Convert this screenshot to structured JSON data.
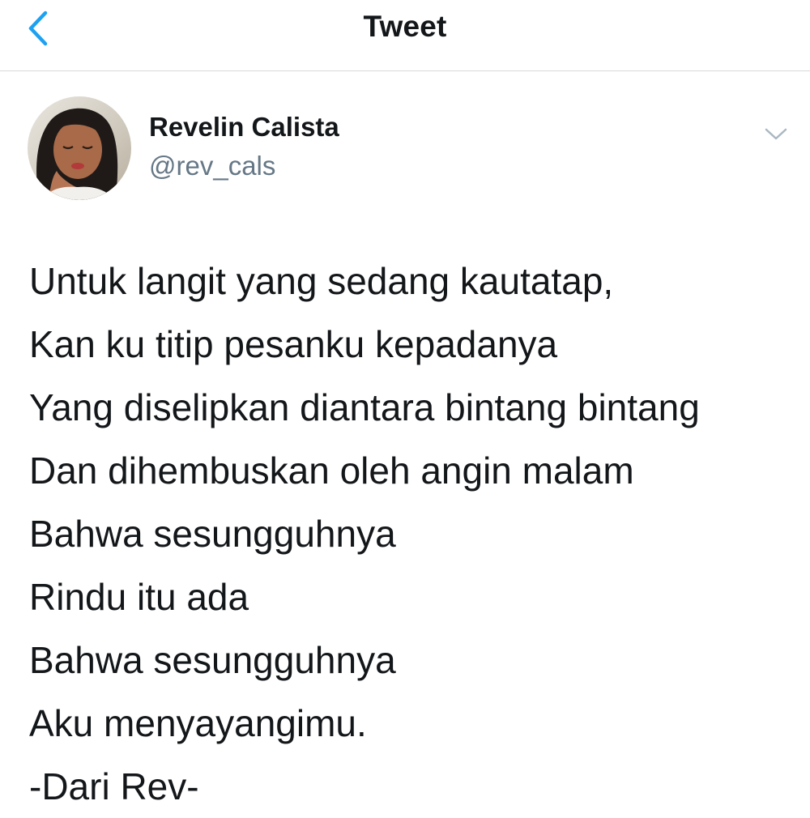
{
  "nav": {
    "title": "Tweet",
    "back_icon": "chevron-left-icon",
    "accent_color": "#1da1f2"
  },
  "tweet": {
    "author": {
      "name": "Revelin Calista",
      "handle": "@rev_cals",
      "avatar_icon": "user-avatar-photo"
    },
    "menu_icon": "chevron-down-icon",
    "lines": [
      "Untuk langit yang sedang kautatap,",
      "Kan ku titip pesanku kepadanya",
      "Yang diselipkan diantara bintang bintang",
      "Dan dihembuskan oleh angin malam",
      "Bahwa sesungguhnya",
      "Rindu itu ada",
      "Bahwa sesungguhnya",
      "Aku menyayangimu.",
      "-Dari Rev-"
    ]
  }
}
